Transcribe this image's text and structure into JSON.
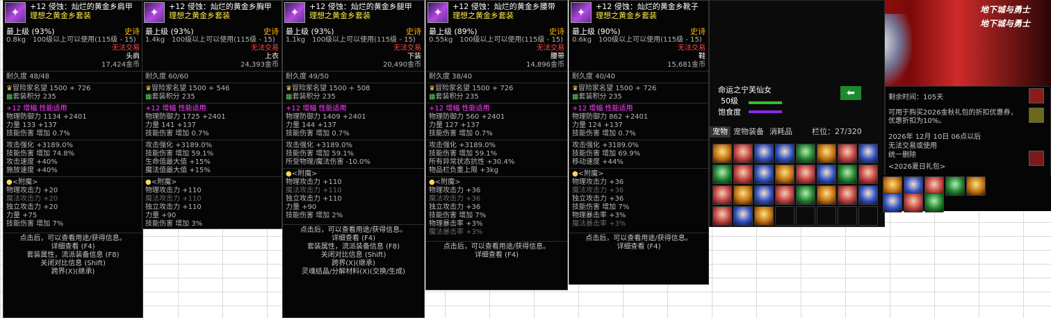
{
  "tooltips": [
    {
      "title": "+12 侵蚀：灿烂的黄金乡肩甲",
      "set": "理想之黄金乡套装",
      "grade": "最上级 (93%)",
      "rarity": "史诗",
      "weight_level": "0.8kg　100级以上可以使用(115级 - 15)",
      "trade": "无法交易",
      "slot": "头肩",
      "price": "17,424金币",
      "durability": "耐久度 48/48",
      "fame": "冒险家名望 1500 + 726",
      "setpts": "套装积分 235",
      "amp": "+12 增幅 性能适用",
      "def": "物理防御力 1134 +2401",
      "str": "力量 133 +137",
      "skill": "技能伤害 增加 0.7%",
      "opts": [
        "攻击强化 +3189.0%",
        "技能伤害 增加 74.8%",
        "攻击速度 +40%",
        "施放速度 +40%"
      ],
      "ench_title": "<附魔>",
      "ench": [
        "物理攻击力 +20",
        "魔法攻击力 +20",
        "独立攻击力 +20",
        "力量 +75",
        "技能伤害 增加 7%"
      ],
      "ench_dim": [
        1
      ],
      "footer": [
        "点击后，可以查看用途/获得信息。",
        "详细查看 (F4)",
        "套装属性，流派装备信息 (F8)",
        "关闭对比信息 (Shift)",
        "跨界(X)(继承)"
      ]
    },
    {
      "title": "+12 侵蚀：灿烂的黄金乡胸甲",
      "set": "理想之黄金乡套装",
      "grade": "最上级 (93%)",
      "rarity": "史诗",
      "weight_level": "1.4kg　100级以上可以使用(115级 - 15)",
      "trade": "无法交易",
      "slot": "上衣",
      "price": "24,393金币",
      "durability": "耐久度 60/60",
      "fame": "冒险家名望 1500 + 546",
      "setpts": "套装积分 235",
      "amp": "+12 增幅 性能适用",
      "def": "物理防御力 1725 +2401",
      "str": "力量 141 +137",
      "skill": "技能伤害 增加 0.7%",
      "opts": [
        "攻击强化 +3189.0%",
        "技能伤害 增加 59.1%",
        "生命值最大值 +15%",
        "魔法值最大值 +15%"
      ],
      "ench_title": "<附魔>",
      "ench": [
        "物理攻击力 +110",
        "魔法攻击力 +110",
        "独立攻击力 +110",
        "力量 +90",
        "技能伤害 增加 3%"
      ],
      "ench_dim": [
        1
      ],
      "footer": []
    },
    {
      "title": "+12 侵蚀：灿烂的黄金乡腿甲",
      "set": "理想之黄金乡套装",
      "grade": "最上级 (93%)",
      "rarity": "史诗",
      "weight_level": "1.1kg　100级以上可以使用(115级 - 15)",
      "trade": "无法交易",
      "slot": "下装",
      "price": "20,490金币",
      "durability": "耐久度 49/50",
      "fame": "冒险家名望 1500 + 508",
      "setpts": "套装积分 235",
      "amp": "+12 增幅 性能适用",
      "def": "物理防御力 1409 +2401",
      "str": "力量 144 +137",
      "skill": "技能伤害 增加 0.7%",
      "opts": [
        "攻击强化 +3189.0%",
        "技能伤害 增加 59.1%",
        "所受物理/魔法伤害 -10.0%"
      ],
      "ench_title": "<附魔>",
      "ench": [
        "物理攻击力 +110",
        "魔法攻击力 +110",
        "独立攻击力 +110",
        "力量 +90",
        "技能伤害 增加 2%"
      ],
      "ench_dim": [
        1
      ],
      "footer": [
        "点击后，可以查看用途/获得信息。",
        "详细查看 (F4)",
        "套装属性，流派装备信息 (F8)",
        "关闭对比信息 (Shift)",
        "跨界(X)(继承)",
        "灵魂结晶/分解材料(X)(交换/生成)"
      ]
    },
    {
      "title": "+12 侵蚀：灿烂的黄金乡腰带",
      "set": "理想之黄金乡套装",
      "grade": "最上级 (89%)",
      "rarity": "史诗",
      "weight_level": "0.55kg　100级以上可以使用(115级 - 15)",
      "trade": "无法交易",
      "slot": "腰带",
      "price": "14,896金币",
      "durability": "耐久度 38/40",
      "fame": "冒险家名望 1500 + 726",
      "setpts": "套装积分 235",
      "amp": "+12 增幅 性能适用",
      "def": "物理防御力 560 +2401",
      "str": "力量 127 +137",
      "skill": "技能伤害 增加 0.7%",
      "opts": [
        "攻击强化 +3189.0%",
        "技能伤害 增加 59.1%",
        "所有异常状态抗性 +30.4%",
        "物品栏负重上限 +3kg"
      ],
      "ench_title": "<附魔>",
      "ench": [
        "物理攻击力 +36",
        "魔法攻击力 +36",
        "独立攻击力 +36",
        "技能伤害 增加 7%",
        "物理暴击率 +3%",
        "魔法暴击率 +3%"
      ],
      "ench_dim": [
        1,
        5
      ],
      "footer": [
        "点击后，可以查看用途/获得信息。",
        "详细查看 (F4)"
      ]
    },
    {
      "title": "+12 侵蚀：灿烂的黄金乡靴子",
      "set": "理想之黄金乡套装",
      "grade": "最上级 (90%)",
      "rarity": "史诗",
      "weight_level": "0.6kg　100级以上可以使用(115级 - 15)",
      "trade": "无法交易",
      "slot": "鞋",
      "price": "15,681金币",
      "durability": "耐久度 40/40",
      "fame": "冒险家名望 1500 + 726",
      "setpts": "套装积分 235",
      "amp": "+12 增幅 性能适用",
      "def": "物理防御力 862 +2401",
      "str": "力量 124 +137",
      "skill": "技能伤害 增加 0.7%",
      "opts": [
        "攻击强化 +3189.0%",
        "技能伤害 增加 69.9%",
        "移动速度 +44%"
      ],
      "ench_title": "<附魔>",
      "ench": [
        "物理攻击力 +36",
        "魔法攻击力 +36",
        "独立攻击力 +36",
        "技能伤害 增加 7%",
        "物理暴击率 +3%",
        "魔法暴击率 +3%"
      ],
      "ench_dim": [
        1,
        5
      ],
      "footer": [
        "点击后，可以查看用途/获得信息。",
        "详细查看 (F4)"
      ]
    }
  ],
  "pet": {
    "name": "命运之宁芙仙女",
    "level": "50级",
    "hunger": "饱食度",
    "tabs": [
      "宠物",
      "宠物装备",
      "消耗品"
    ],
    "slot_label": "栏位：27/320"
  },
  "gift": {
    "remain": "剩余时间：105天",
    "desc": "可用于购买2026金秋礼包的折扣优惠券，优惠折扣为10%。",
    "date": "2026年 12月 10日 06点以后",
    "notrade": "无法交易或使用",
    "delete": "统一删除",
    "name": "<2026夏日礼包>"
  },
  "banner": {
    "logo": "地下城与勇士"
  }
}
